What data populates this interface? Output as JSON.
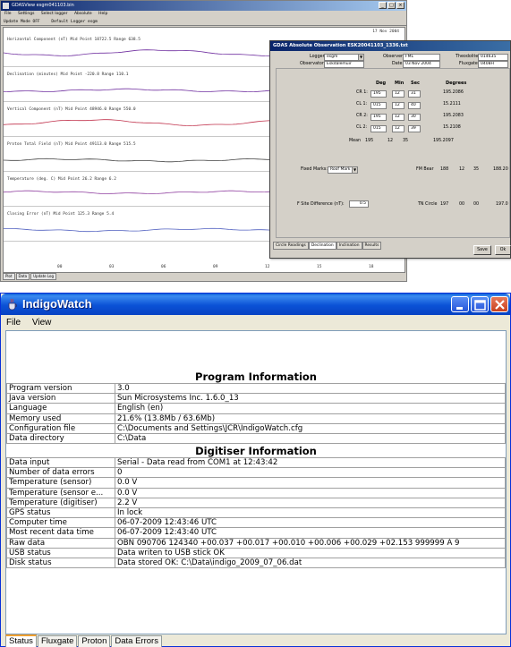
{
  "gdas": {
    "title": "GDASView esgm041103.bin",
    "menu": [
      "File",
      "Settings",
      "Select logger",
      "Absolute",
      "Help"
    ],
    "mode": [
      "Update Mode OFF",
      "Default Logger esgm"
    ],
    "date": "17 Nov 2004",
    "traces": [
      {
        "label": "Horizontal Component (nT)    Mid Point 18722.5  Range 638.5",
        "color": "#7030a0"
      },
      {
        "label": "Declination (minutes)    Mid Point -220.8  Range 110.1",
        "color": "#7030a0"
      },
      {
        "label": "Vertical Component (nT)    Mid Point 48946.0  Range 550.0",
        "color": "#c0304a"
      },
      {
        "label": "Proton Total Field (nT)    Mid Point 49113.0  Range 515.5",
        "color": "#404040"
      },
      {
        "label": "Temperature (deg. C)    Mid Point 26.2  Range 6.2",
        "color": "#9040a0"
      },
      {
        "label": "Closing Error (nT)    Mid Point 125.3  Range 5.4",
        "color": "#5060c0"
      }
    ],
    "xticks": [
      "00",
      "03",
      "06",
      "09",
      "12",
      "15",
      "18"
    ],
    "bottom_tabs": [
      "Plot",
      "Data",
      "Update Log"
    ]
  },
  "obs": {
    "title": "GDAS Absolute Observation ESK20041103_1336.txt",
    "logger_label": "Logger:",
    "logger_value": "esgm",
    "observatory_label": "Observatory:",
    "observatory_value": "Eskdalemuir",
    "observer_label": "Observer:",
    "observer_value": "FML",
    "date_label": "Date:",
    "date_value": "03 Nov 2004",
    "theodolite_label": "Theodolite:",
    "theodolite_value": "014635",
    "fluxgate_label": "Fluxgate:",
    "fluxgate_value": "0408H",
    "headers": [
      "Deg",
      "Min",
      "Sec",
      "Degrees"
    ],
    "rows": [
      {
        "label": "CR 1:",
        "deg": "195",
        "min": "12",
        "sec": "31",
        "degrees": "195.2086"
      },
      {
        "label": "CL 1:",
        "deg": "015",
        "min": "12",
        "sec": "40",
        "degrees": "15.2111"
      },
      {
        "label": "CR 2:",
        "deg": "195",
        "min": "12",
        "sec": "30",
        "degrees": "195.2083"
      },
      {
        "label": "CL 2:",
        "deg": "015",
        "min": "12",
        "sec": "39",
        "degrees": "15.2108"
      }
    ],
    "mean_label": "Mean",
    "mean": {
      "deg": "195",
      "min": "12",
      "sec": "35",
      "degrees": "195.2097"
    },
    "fixed_marks_label": "Fixed Marks:",
    "fixed_marks_value": "Roof Mark",
    "fm_bear_label": "FM Bear",
    "fm_bear": [
      "188",
      "12",
      "35",
      "188.20"
    ],
    "f_site_label": "F Site Difference (nT):",
    "f_site_value": "0.5",
    "tn_circle_label": "TN Circle",
    "tn_circle": [
      "197",
      "00",
      "00",
      "197.0"
    ],
    "tabs": [
      "Circle Readings",
      "Declination",
      "Inclination",
      "Results"
    ],
    "save_label": "Save",
    "ok_label": "Ok"
  },
  "iw": {
    "title": "IndigoWatch",
    "menu": [
      "File",
      "View"
    ],
    "program_title": "Program Information",
    "program": [
      {
        "k": "Program version",
        "v": "3.0"
      },
      {
        "k": "Java version",
        "v": "Sun Microsystems Inc. 1.6.0_13"
      },
      {
        "k": "Language",
        "v": "English (en)"
      },
      {
        "k": "Memory used",
        "v": "21.6% (13.8Mb / 63.6Mb)"
      },
      {
        "k": "Configuration file",
        "v": "C:\\Documents and Settings\\JCR\\IndigoWatch.cfg"
      },
      {
        "k": "Data directory",
        "v": "C:\\Data"
      }
    ],
    "digitiser_title": "Digitiser Information",
    "digitiser": [
      {
        "k": "Data input",
        "v": "Serial - Data read from COM1 at 12:43:42"
      },
      {
        "k": "Number of data errors",
        "v": "0"
      },
      {
        "k": "Temperature (sensor)",
        "v": "0.0 V"
      },
      {
        "k": "Temperature (sensor e...",
        "v": "0.0 V"
      },
      {
        "k": "Temperature (digitiser)",
        "v": "2.2 V"
      },
      {
        "k": "GPS status",
        "v": "In lock"
      },
      {
        "k": "Computer time",
        "v": "06-07-2009 12:43:46 UTC"
      },
      {
        "k": "Most recent data time",
        "v": "06-07-2009 12:43:40 UTC"
      },
      {
        "k": "Raw data",
        "v": "OBN 090706 124340 +00.037 +00.017 +00.010 +00.006 +00.029 +02.153 999999 A 9"
      },
      {
        "k": "USB status",
        "v": "Data writen to USB stick OK"
      },
      {
        "k": "Disk status",
        "v": "Data stored OK: C:\\Data\\indigo_2009_07_06.dat"
      }
    ],
    "tabs": [
      "Status",
      "Fluxgate",
      "Proton",
      "Data Errors"
    ]
  }
}
